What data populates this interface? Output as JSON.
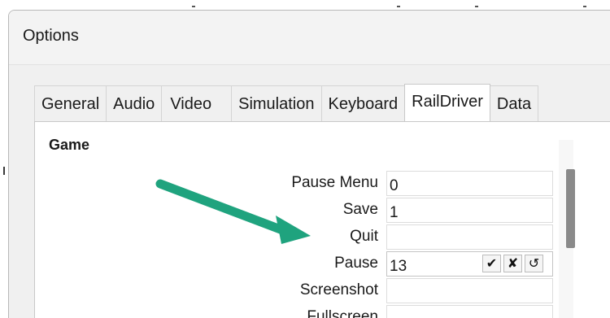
{
  "window": {
    "title": "Options"
  },
  "tabs": [
    {
      "label": "General",
      "active": false
    },
    {
      "label": "Audio",
      "active": false
    },
    {
      "label": "Video",
      "active": false
    },
    {
      "label": "Simulation",
      "active": false
    },
    {
      "label": "Keyboard",
      "active": false
    },
    {
      "label": "RailDriver",
      "active": true
    },
    {
      "label": "Data",
      "active": false
    }
  ],
  "section": {
    "title": "Game"
  },
  "rows": [
    {
      "label": "Pause Menu",
      "value": "0"
    },
    {
      "label": "Save",
      "value": "1"
    },
    {
      "label": "Quit",
      "value": ""
    },
    {
      "label": "Pause",
      "value": "13"
    },
    {
      "label": "Screenshot",
      "value": ""
    },
    {
      "label": "Fullscreen",
      "value": ""
    }
  ],
  "row_buttons": {
    "accept_icon": "checkmark-icon",
    "accept_glyph": "✔",
    "clear_icon": "x-icon",
    "clear_glyph": "✘",
    "reset_icon": "undo-icon",
    "reset_glyph": "↺"
  },
  "annotation": {
    "color": "#1fa37e"
  }
}
